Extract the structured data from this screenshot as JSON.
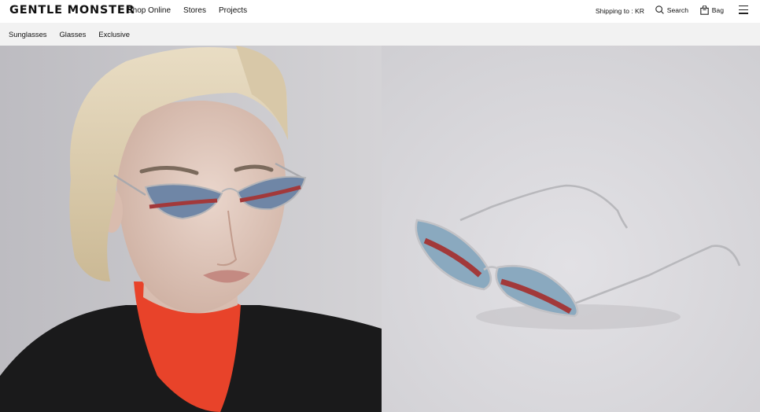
{
  "brand": {
    "logo": "GENTLE MONSTER"
  },
  "main_nav": [
    {
      "label": "Shop Online"
    },
    {
      "label": "Stores"
    },
    {
      "label": "Projects"
    }
  ],
  "utility": {
    "shipping": "Shipping to : KR",
    "search": "Search",
    "bag": "Bag",
    "icons": {
      "search": "search-icon",
      "bag": "bag-icon",
      "menu": "hamburger-menu-icon"
    }
  },
  "sub_nav": [
    {
      "label": "Sunglasses"
    },
    {
      "label": "Glasses"
    },
    {
      "label": "Exclusive"
    }
  ],
  "colors": {
    "lens": "#6f86a6",
    "stripe": "#a2393a",
    "turtleneck": "#e8432a",
    "jacket": "#1a1a1b"
  }
}
